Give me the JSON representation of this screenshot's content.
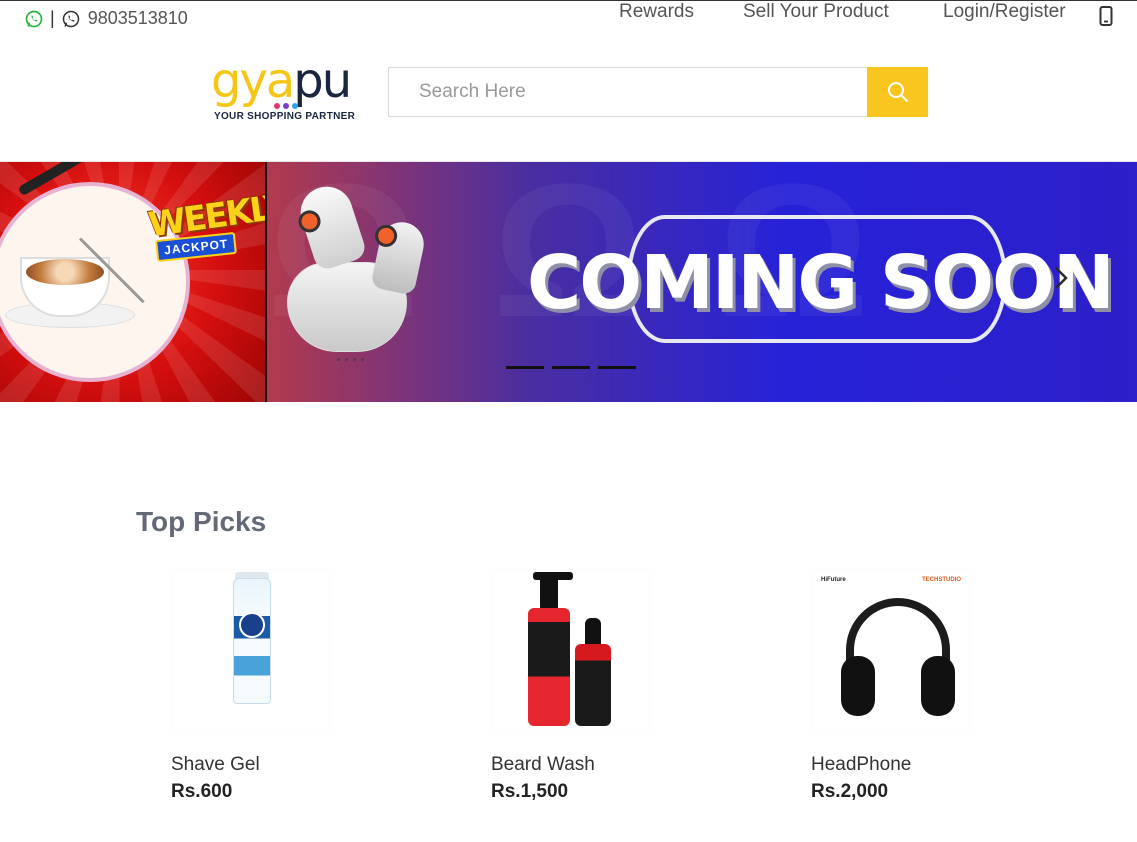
{
  "topbar": {
    "phone": "9803513810",
    "separator": "|",
    "links": [
      "Rewards",
      "Sell Your Product",
      "Login/Register"
    ]
  },
  "header": {
    "logo_text": "gyapu",
    "logo_tagline": "YOUR SHOPPING PARTNER",
    "search_placeholder": "Search Here",
    "search_value": ""
  },
  "banner": {
    "left_badge": "WEEKLY",
    "left_ribbon": "JACKPOT",
    "headline": "COMING SOON",
    "slide_count": 3,
    "active_slide": 3
  },
  "top_picks": {
    "title": "Top Picks",
    "products": [
      {
        "name": "Shave Gel",
        "price": "Rs.600"
      },
      {
        "name": "Beard Wash",
        "price": "Rs.1,500"
      },
      {
        "name": "HeadPhone",
        "price": "Rs.2,000",
        "brand_left": "HiFuture",
        "brand_right": "TECHSTUDIO"
      }
    ]
  },
  "colors": {
    "brand_yellow": "#f9c51f",
    "brand_navy": "#1a2540",
    "section_title": "#636a75",
    "banner_blue": "#2622d8",
    "banner_red": "#d40e0e"
  },
  "icons": [
    "whatsapp-icon",
    "viber-icon",
    "mobile-icon",
    "search-icon",
    "chevron-right-icon"
  ]
}
